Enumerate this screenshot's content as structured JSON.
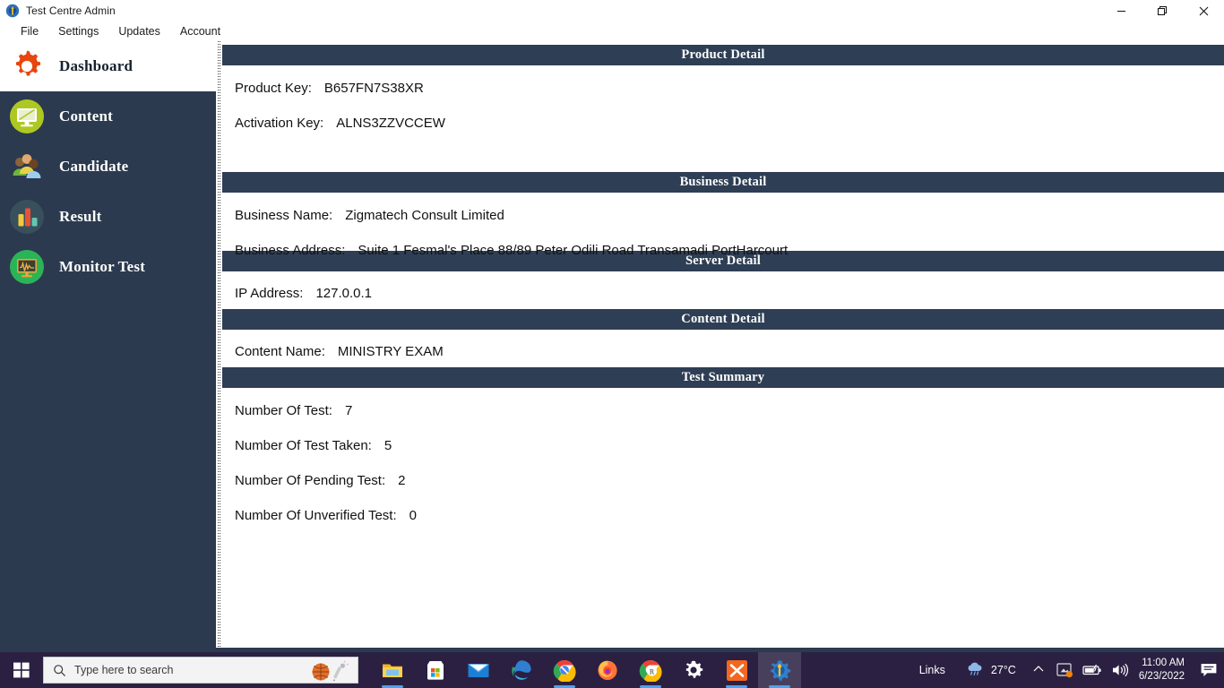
{
  "window": {
    "title": "Test Centre Admin",
    "app_icon": "app-gear-wrench-icon",
    "minimize_label": "Minimize",
    "restore_label": "Restore",
    "close_label": "Close"
  },
  "menubar": {
    "items": [
      {
        "label": "File",
        "name": "menu-file"
      },
      {
        "label": "Settings",
        "name": "menu-settings"
      },
      {
        "label": "Updates",
        "name": "menu-updates"
      },
      {
        "label": "Account",
        "name": "menu-account"
      }
    ]
  },
  "sidebar": {
    "items": [
      {
        "label": "Dashboard",
        "icon": "gear-icon",
        "active": true
      },
      {
        "label": "Content",
        "icon": "monitor-icon",
        "active": false
      },
      {
        "label": "Candidate",
        "icon": "users-icon",
        "active": false
      },
      {
        "label": "Result",
        "icon": "bar-chart-icon",
        "active": false
      },
      {
        "label": "Monitor Test",
        "icon": "waveform-monitor-icon",
        "active": false
      }
    ]
  },
  "content": {
    "sections": [
      {
        "title": "Product Detail",
        "rows": [
          {
            "label": "Product Key:",
            "value": "B657FN7S38XR"
          },
          {
            "label": "Activation Key:",
            "value": "ALNS3ZZVCCEW"
          }
        ]
      },
      {
        "title": "Business Detail",
        "rows": [
          {
            "label": "Business Name:",
            "value": "Zigmatech Consult Limited"
          },
          {
            "label": "Business Address:",
            "value": "Suite 1 Fesmal's Place 88/89 Peter Odili Road Transamadi PortHarcourt"
          }
        ]
      },
      {
        "title": "Server Detail",
        "rows": [
          {
            "label": "IP Address:",
            "value": "127.0.0.1"
          }
        ]
      },
      {
        "title": "Content Detail",
        "rows": [
          {
            "label": "Content Name:",
            "value": "MINISTRY EXAM"
          }
        ]
      },
      {
        "title": "Test Summary",
        "rows": [
          {
            "label": "Number Of Test:",
            "value": "7"
          },
          {
            "label": "Number Of Test Taken:",
            "value": "5"
          },
          {
            "label": "Number Of Pending Test:",
            "value": "2"
          },
          {
            "label": "Number Of Unverified Test:",
            "value": "0"
          }
        ]
      }
    ]
  },
  "taskbar": {
    "start_label": "Start",
    "search": {
      "placeholder": "Type here to search",
      "value": ""
    },
    "apps": [
      {
        "name": "file-explorer-icon",
        "running": true
      },
      {
        "name": "microsoft-store-icon",
        "running": false
      },
      {
        "name": "mail-icon",
        "running": false
      },
      {
        "name": "edge-icon",
        "running": false
      },
      {
        "name": "chrome-beta-icon",
        "running": true
      },
      {
        "name": "firefox-icon",
        "running": false
      },
      {
        "name": "chrome-r-icon",
        "running": true
      },
      {
        "name": "settings-gear-icon",
        "running": false
      },
      {
        "name": "xampp-icon",
        "running": true
      },
      {
        "name": "test-centre-admin-icon",
        "running": true
      }
    ],
    "tray": {
      "links_label": "Links",
      "weather_temp": "27°C",
      "weather_icon": "cloud-rain-icon",
      "chevron_icon": "chevron-up-icon",
      "icons": [
        "onedrive-sync-icon",
        "battery-icon",
        "volume-icon"
      ],
      "time": "11:00 AM",
      "date": "6/23/2022",
      "action_center_icon": "action-center-icon"
    }
  },
  "colors": {
    "sidebar_bg": "#2b3a4f",
    "section_header_bg": "#2e3e54",
    "taskbar_bg": "#2b2042",
    "accent_orange": "#e8450f",
    "active_item_bg": "#ffffff"
  }
}
